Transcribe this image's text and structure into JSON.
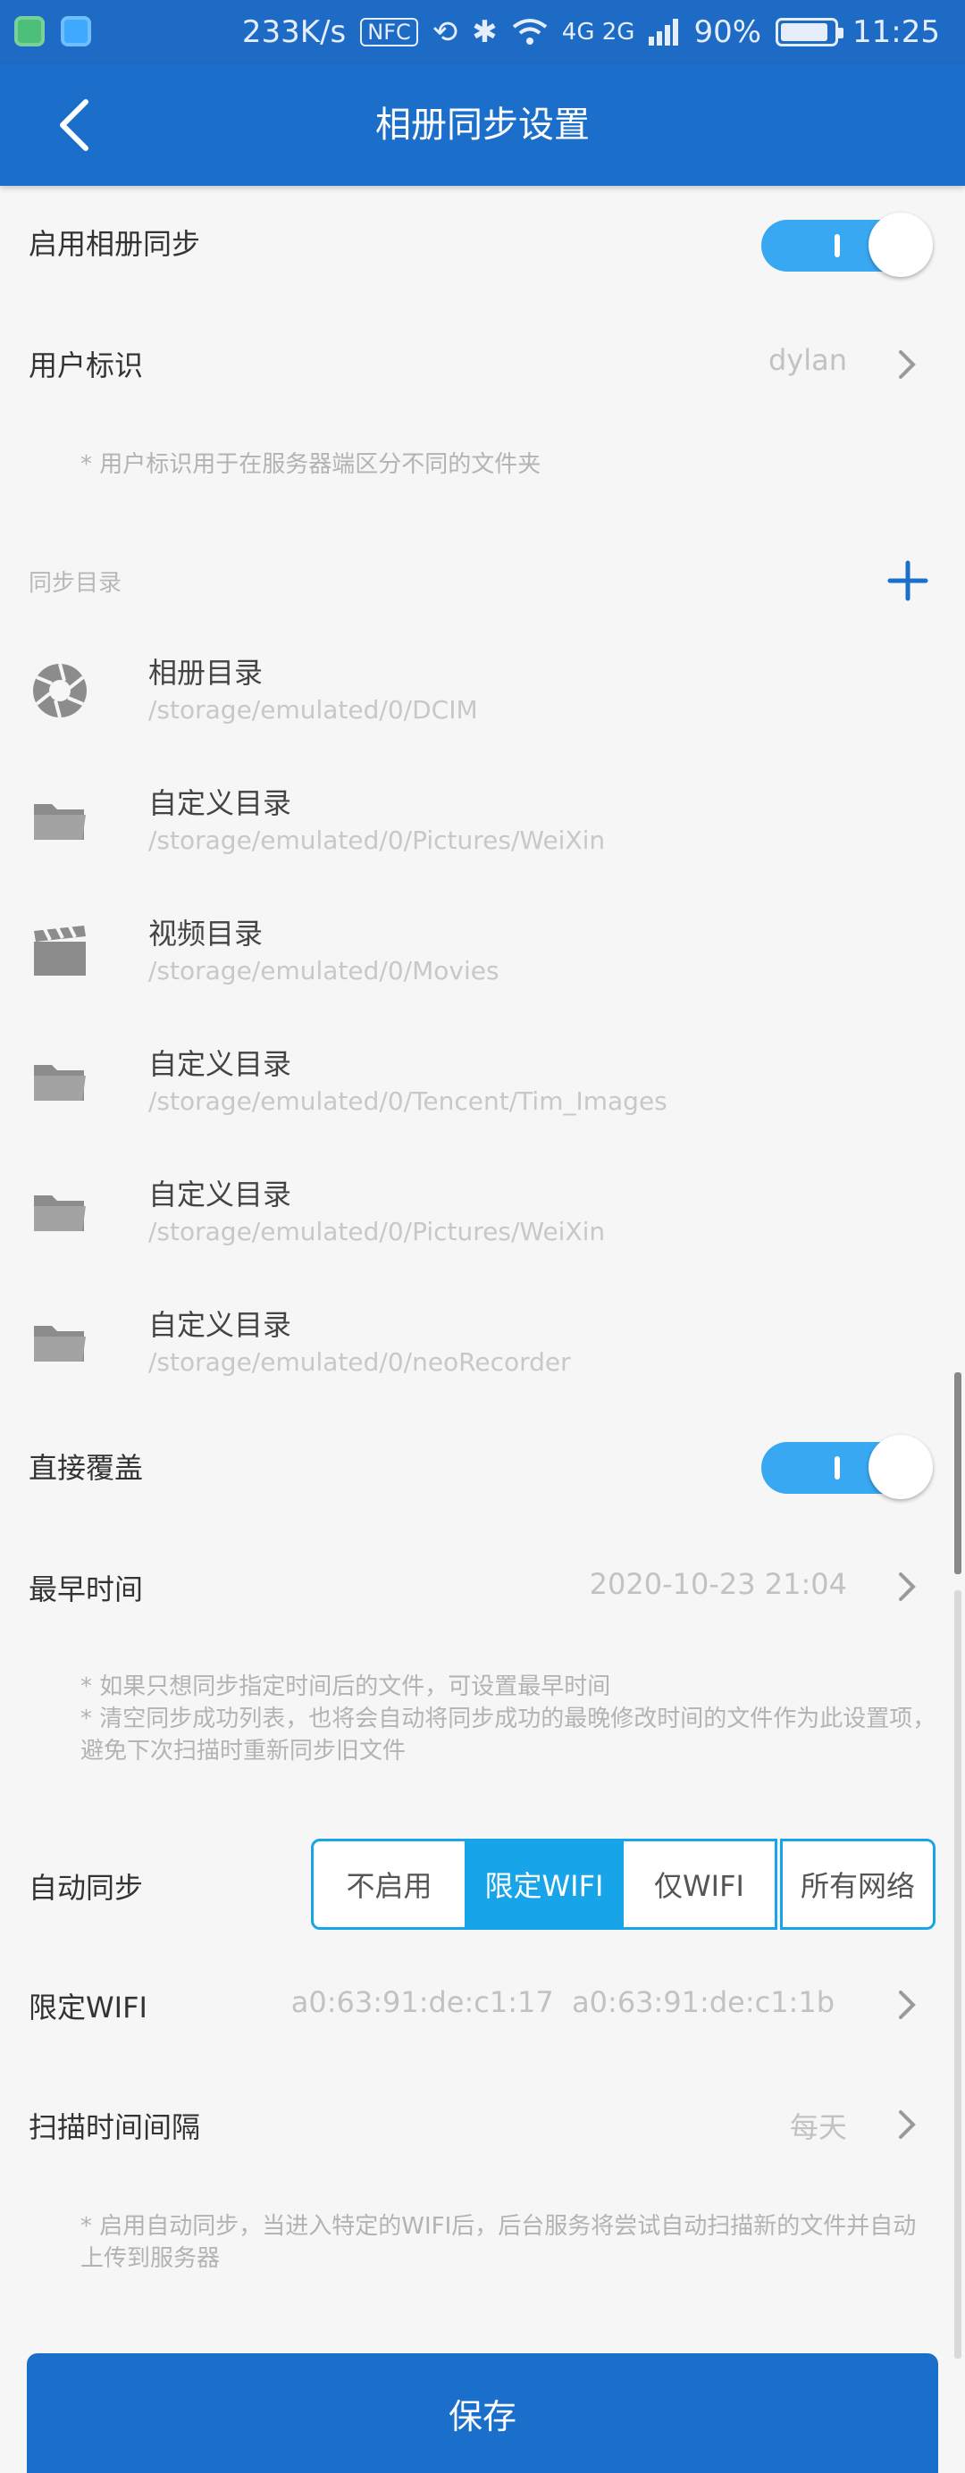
{
  "status_bar": {
    "speed": "233K/s",
    "nfc": "NFC",
    "network": "4G 2G",
    "battery": "90%",
    "battery_level": 0.9,
    "time": "11:25"
  },
  "header": {
    "title": "相册同步设置"
  },
  "enable_sync": {
    "label": "启用相册同步",
    "on": true
  },
  "user_id": {
    "label": "用户标识",
    "value": "dylan",
    "note": "* 用户标识用于在服务器端区分不同的文件夹"
  },
  "sync_dirs": {
    "label": "同步目录",
    "items": [
      {
        "icon": "camera-aperture-icon",
        "name": "相册目录",
        "path": "/storage/emulated/0/DCIM"
      },
      {
        "icon": "folder-icon",
        "name": "自定义目录",
        "path": "/storage/emulated/0/Pictures/WeiXin"
      },
      {
        "icon": "film-clapper-icon",
        "name": "视频目录",
        "path": "/storage/emulated/0/Movies"
      },
      {
        "icon": "folder-icon",
        "name": "自定义目录",
        "path": "/storage/emulated/0/Tencent/Tim_Images"
      },
      {
        "icon": "folder-icon",
        "name": "自定义目录",
        "path": "/storage/emulated/0/Pictures/WeiXin"
      },
      {
        "icon": "folder-icon",
        "name": "自定义目录",
        "path": "/storage/emulated/0/neoRecorder"
      }
    ]
  },
  "overwrite": {
    "label": "直接覆盖",
    "on": true
  },
  "earliest_time": {
    "label": "最早时间",
    "value": "2020-10-23 21:04",
    "note_line1": "* 如果只想同步指定时间后的文件，可设置最早时间",
    "note_line2": "* 清空同步成功列表，也将会自动将同步成功的最晚修改时间的文件作为此设置项，避免下次扫描时重新同步旧文件"
  },
  "auto_sync": {
    "label": "自动同步",
    "options": [
      "不启用",
      "限定WIFI",
      "仅WIFI",
      "所有网络"
    ],
    "selected": "限定WIFI"
  },
  "limited_wifi": {
    "label": "限定WIFI",
    "value": "a0:63:91:de:c1:17  a0:63:91:de:c1:1b"
  },
  "scan_interval": {
    "label": "扫描时间间隔",
    "value": "每天",
    "note": "* 启用自动同步，当进入特定的WIFI后，后台服务将尝试自动扫描新的文件并自动上传到服务器"
  },
  "save_label": "保存",
  "colors": {
    "primary": "#1b6fcb",
    "accent": "#18a4e8",
    "toggle": "#39a8f2"
  }
}
